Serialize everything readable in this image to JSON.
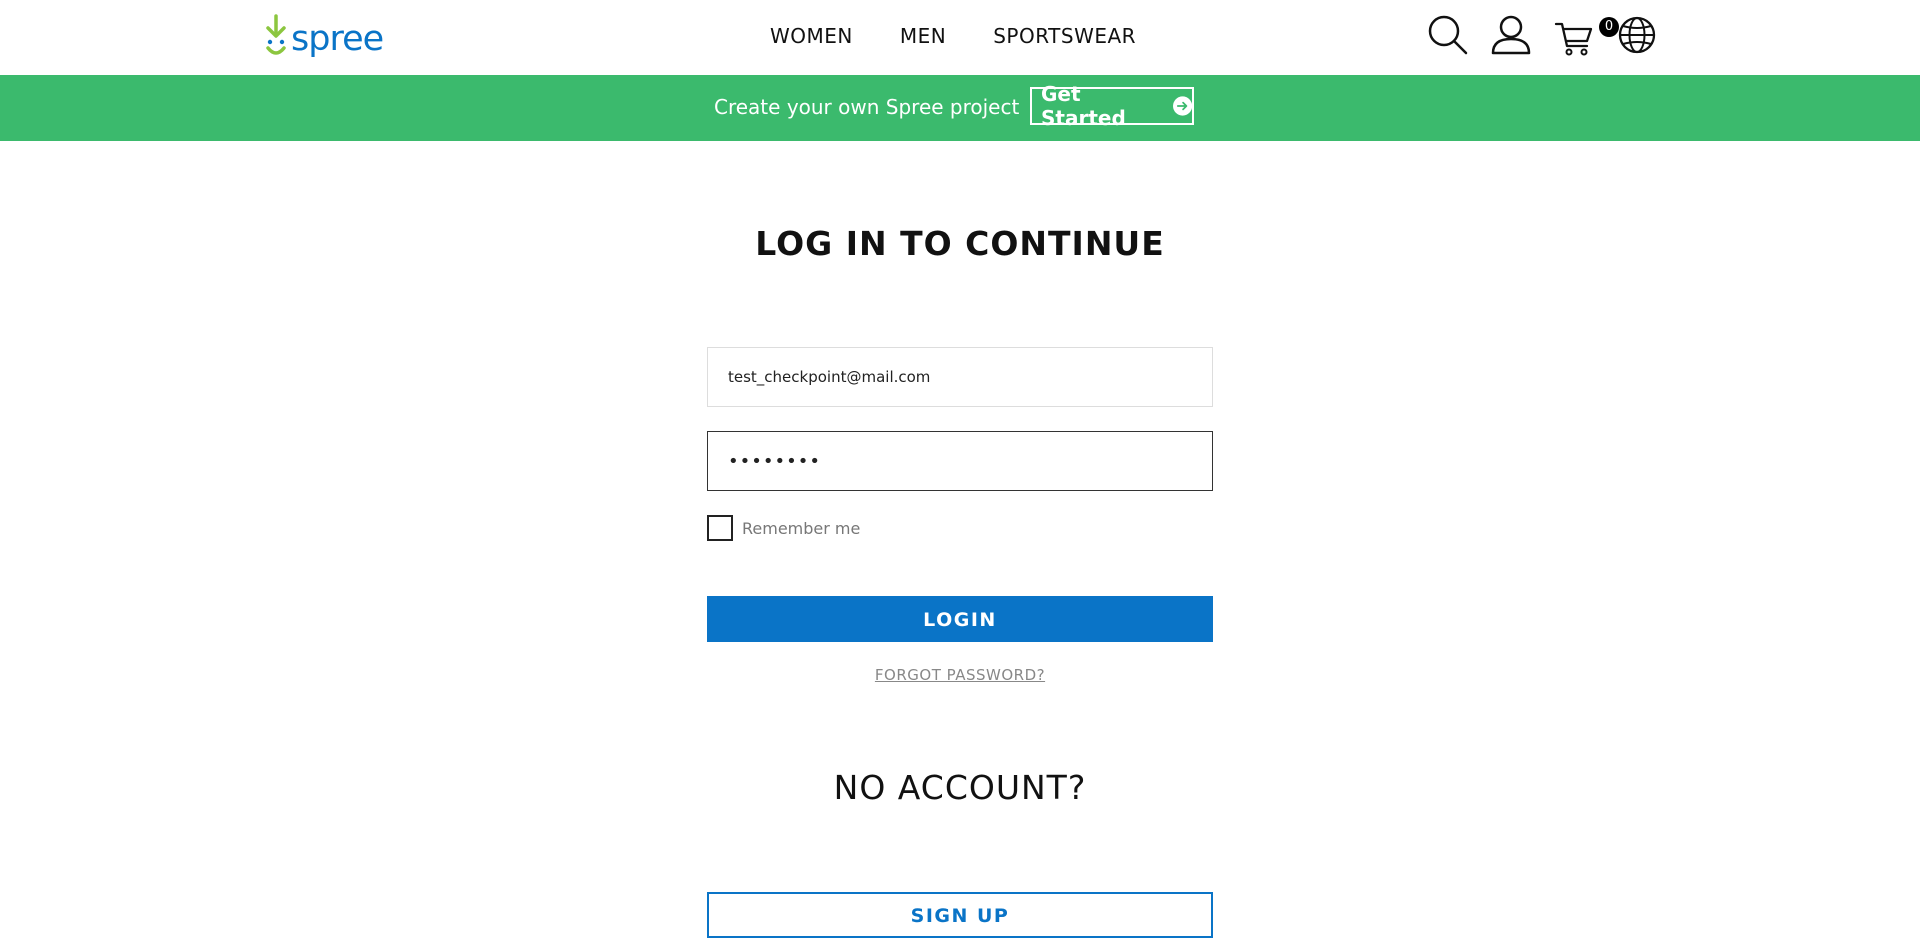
{
  "brand": {
    "name": "spree",
    "logo_icon": "spree-sprout-logo",
    "colors": {
      "primary": "#0a74c7",
      "promo": "#3bba6d",
      "logo_green": "#8cc63f"
    }
  },
  "nav": {
    "items": [
      "WOMEN",
      "MEN",
      "SPORTSWEAR"
    ]
  },
  "header_icons": {
    "search": "search-icon",
    "account": "user-icon",
    "cart": "cart-icon",
    "cart_count": "0",
    "locale": "globe-icon"
  },
  "promo": {
    "text": "Create your own Spree project",
    "button_label": "Get Started",
    "button_icon": "arrow-right-circle-icon"
  },
  "login": {
    "title": "LOG IN TO CONTINUE",
    "email_value": "test_checkpoint@mail.com",
    "password_value": "••••••••",
    "remember_label": "Remember me",
    "remember_checked": false,
    "login_button": "LOGIN",
    "forgot_link": "FORGOT PASSWORD?"
  },
  "signup": {
    "title": "NO ACCOUNT?",
    "button": "SIGN UP"
  }
}
